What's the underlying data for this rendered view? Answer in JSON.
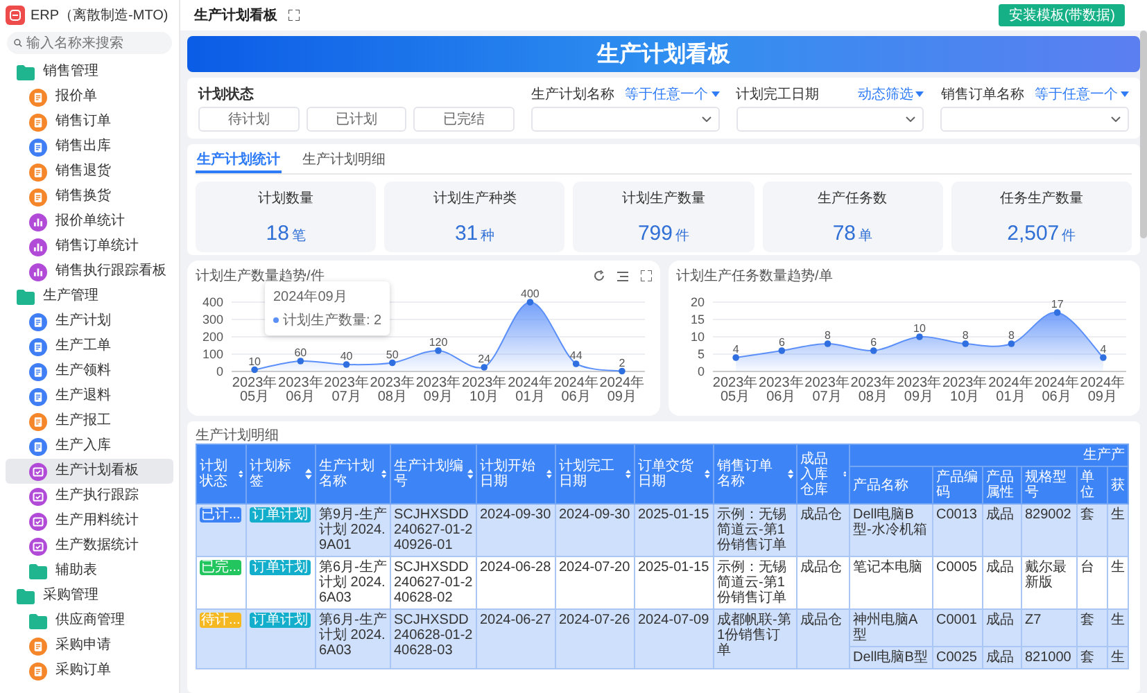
{
  "sidebar": {
    "app_title": "ERP（离散制造-MTO)",
    "search": {
      "placeholder": "输入名称来搜索"
    },
    "groups": [
      {
        "label": "销售管理",
        "kind": "folder",
        "selected": false,
        "children": [
          {
            "label": "报价单",
            "kind": "form",
            "color": "#f5862a",
            "selected": false
          },
          {
            "label": "销售订单",
            "kind": "form",
            "color": "#f5862a",
            "selected": false
          },
          {
            "label": "销售出库",
            "kind": "form",
            "color": "#3f7ef5",
            "selected": false
          },
          {
            "label": "销售退货",
            "kind": "form",
            "color": "#f5862a",
            "selected": false
          },
          {
            "label": "销售换货",
            "kind": "form",
            "color": "#f5862a",
            "selected": false
          },
          {
            "label": "报价单统计",
            "kind": "chart",
            "color": "#b24ad8",
            "selected": false
          },
          {
            "label": "销售订单统计",
            "kind": "chart",
            "color": "#b24ad8",
            "selected": false
          },
          {
            "label": "销售执行跟踪看板",
            "kind": "chart",
            "color": "#b24ad8",
            "selected": false
          }
        ]
      },
      {
        "label": "生产管理",
        "kind": "folder",
        "selected": false,
        "children": [
          {
            "label": "生产计划",
            "kind": "form",
            "color": "#3f7ef5",
            "selected": false
          },
          {
            "label": "生产工单",
            "kind": "form",
            "color": "#3f7ef5",
            "selected": false
          },
          {
            "label": "生产领料",
            "kind": "form",
            "color": "#3f7ef5",
            "selected": false
          },
          {
            "label": "生产退料",
            "kind": "form",
            "color": "#3f7ef5",
            "selected": false
          },
          {
            "label": "生产报工",
            "kind": "form",
            "color": "#f5862a",
            "selected": false
          },
          {
            "label": "生产入库",
            "kind": "form",
            "color": "#3f7ef5",
            "selected": false
          },
          {
            "label": "生产计划看板",
            "kind": "dashboard",
            "color": "#b24ad8",
            "selected": true
          },
          {
            "label": "生产执行跟踪",
            "kind": "dashboard",
            "color": "#b24ad8",
            "selected": false
          },
          {
            "label": "生产用料统计",
            "kind": "dashboard",
            "color": "#b24ad8",
            "selected": false
          },
          {
            "label": "生产数据统计",
            "kind": "dashboard",
            "color": "#b24ad8",
            "selected": false
          },
          {
            "label": "辅助表",
            "kind": "folder",
            "selected": false
          }
        ]
      },
      {
        "label": "采购管理",
        "kind": "folder",
        "selected": false,
        "children": [
          {
            "label": "供应商管理",
            "kind": "folder",
            "selected": false
          },
          {
            "label": "采购申请",
            "kind": "form",
            "color": "#f5862a",
            "selected": false
          },
          {
            "label": "采购订单",
            "kind": "form",
            "color": "#f5862a",
            "selected": false
          }
        ]
      }
    ]
  },
  "top_bar": {
    "title": "生产计划看板",
    "install_button": "安装模板(带数据)"
  },
  "banner": {
    "title": "生产计划看板"
  },
  "filters": {
    "status": {
      "label": "计划状态",
      "options": [
        {
          "label": "待计划",
          "selected": false
        },
        {
          "label": "已计划",
          "selected": false
        },
        {
          "label": "已完结",
          "selected": false
        }
      ]
    },
    "fields": [
      {
        "label": "生产计划名称",
        "mode": "等于任意一个"
      },
      {
        "label": "计划完工日期",
        "mode": "动态筛选"
      },
      {
        "label": "销售订单名称",
        "mode": "等于任意一个"
      }
    ]
  },
  "tabs": [
    {
      "label": "生产计划统计",
      "selected": true
    },
    {
      "label": "生产计划明细",
      "selected": false
    }
  ],
  "stats": [
    {
      "label": "计划数量",
      "value": "18",
      "unit": "笔"
    },
    {
      "label": "计划生产种类",
      "value": "31",
      "unit": "种"
    },
    {
      "label": "计划生产数量",
      "value": "799",
      "unit": "件"
    },
    {
      "label": "生产任务数",
      "value": "78",
      "unit": "单"
    },
    {
      "label": "任务生产数量",
      "value": "2,507",
      "unit": "件"
    }
  ],
  "charts": [
    {
      "title": "计划生产数量趋势/件",
      "toolbar": true,
      "tooltip": {
        "title": "2024年09月",
        "label": "计划生产数量: 2"
      },
      "chart_data": {
        "type": "area",
        "categories": [
          "2023年05月",
          "2023年06月",
          "2023年07月",
          "2023年08月",
          "2023年09月",
          "2023年10月",
          "2024年01月",
          "2024年06月",
          "2024年09月"
        ],
        "ylim": [
          0,
          400
        ],
        "yticks": [
          0,
          100,
          200,
          300,
          400
        ],
        "grid": true,
        "data_labels": true,
        "series": [
          {
            "color": "#5b8ff9",
            "values": [
              10,
              60,
              40,
              50,
              120,
              24,
              400,
              44,
              2
            ]
          }
        ]
      }
    },
    {
      "title": "计划生产任务数量趋势/单",
      "toolbar": false,
      "chart_data": {
        "type": "area",
        "categories": [
          "2023年05月",
          "2023年06月",
          "2023年07月",
          "2023年08月",
          "2023年09月",
          "2023年10月",
          "2024年01月",
          "2024年06月",
          "2024年09月"
        ],
        "ylim": [
          0,
          20
        ],
        "yticks": [
          0,
          5,
          10,
          15,
          20
        ],
        "grid": true,
        "data_labels": true,
        "series": [
          {
            "color": "#5b8ff9",
            "values": [
              4,
              6,
              8,
              6,
              10,
              8,
              8,
              17,
              4
            ]
          }
        ]
      }
    }
  ],
  "table": {
    "title": "生产计划明细",
    "columns": [
      "计划状态",
      "计划标签",
      "生产计划名称",
      "生产计划编号",
      "计划开始日期",
      "计划完工日期",
      "订单交货日期",
      "销售订单名称",
      "成品入库仓库"
    ],
    "group_header": "生产产",
    "product_columns": [
      "产品名称",
      "产品编码",
      "产品属性",
      "规格型号",
      "单位",
      "获"
    ],
    "rows": [
      {
        "color": "#3b82f6",
        "cells": [
          "已计...",
          "订单计划",
          "第9月-生产计划 2024.9A01",
          "SCJHXSDD240627-01-240926-01",
          "2024-09-30",
          "2024-09-30",
          "2025-01-15",
          "示例：无锡简道云-第1份销售订单",
          "成品仓"
        ],
        "products": [
          [
            "Dell电脑B型-水冷机箱",
            "C0013",
            "成品",
            "829002",
            "套",
            "生"
          ]
        ]
      },
      {
        "color": "#22c55e",
        "cells": [
          "已完...",
          "订单计划",
          "第6月-生产计划 2024.6A03",
          "SCJHXSDD240627-01-240628-02",
          "2024-06-28",
          "2024-07-20",
          "2025-01-15",
          "示例：无锡简道云-第1份销售订单",
          "成品仓"
        ],
        "products": [
          [
            "笔记本电脑",
            "C0005",
            "成品",
            "戴尔最新版",
            "台",
            "生"
          ]
        ]
      },
      {
        "color": "#f5b820",
        "cells": [
          "待计...",
          "订单计划",
          "第6月-生产计划 2024.6A03",
          "SCJHXSDD240628-01-240628-03",
          "2024-06-27",
          "2024-07-26",
          "2024-07-09",
          "成都帆联-第1份销售订单",
          "成品仓"
        ],
        "products": [
          [
            "神州电脑A型",
            "C0001",
            "成品",
            "Z7",
            "套",
            "生"
          ],
          [
            "Dell电脑B型",
            "C0025",
            "成品",
            "821000",
            "套",
            "生"
          ]
        ]
      }
    ]
  }
}
